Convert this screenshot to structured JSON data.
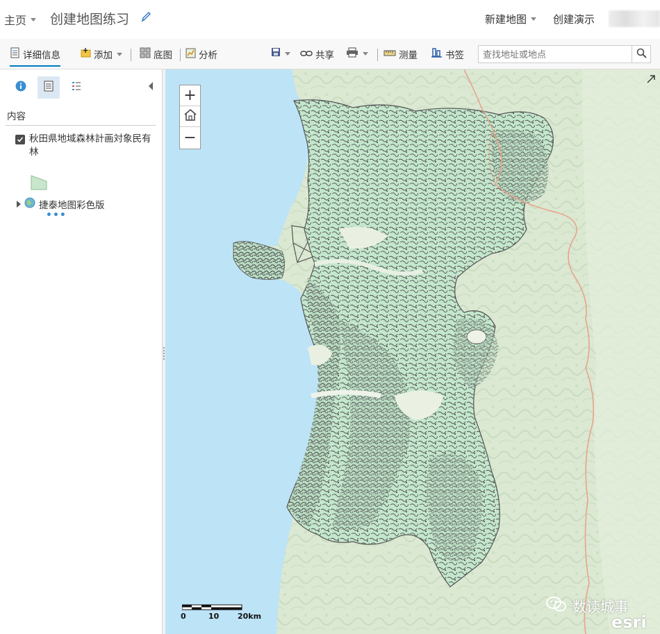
{
  "header": {
    "home_label": "主页",
    "map_title": "创建地图练习",
    "new_map_label": "新建地图",
    "create_presentation_label": "创建演示"
  },
  "toolbar": {
    "details_label": "详细信息",
    "add_label": "添加",
    "basemap_label": "底图",
    "analysis_label": "分析",
    "share_label": "共享",
    "measure_label": "测量",
    "bookmarks_label": "书签",
    "search_placeholder": "查找地址或地点"
  },
  "sidebar": {
    "content_heading": "内容",
    "layers": [
      {
        "name": "秋田県地域森林計画対象民有林",
        "checked": true,
        "legend_color": "#c8e6cc"
      },
      {
        "name": "捷泰地图彩色版",
        "type": "basemap"
      }
    ]
  },
  "map": {
    "scale_labels": [
      "0",
      "10",
      "20km"
    ],
    "watermark_text": "数读城事",
    "attribution_logo": "esri",
    "colors": {
      "sea": "#bde3f7",
      "land": "#e2ecd9",
      "forest_fill": "#c5e8cf",
      "forest_outline": "#555555",
      "road": "#e8a48a"
    }
  },
  "icons": {
    "pencil": "pencil-icon",
    "search": "search-icon",
    "home": "home-icon",
    "expand": "expand-icon"
  }
}
